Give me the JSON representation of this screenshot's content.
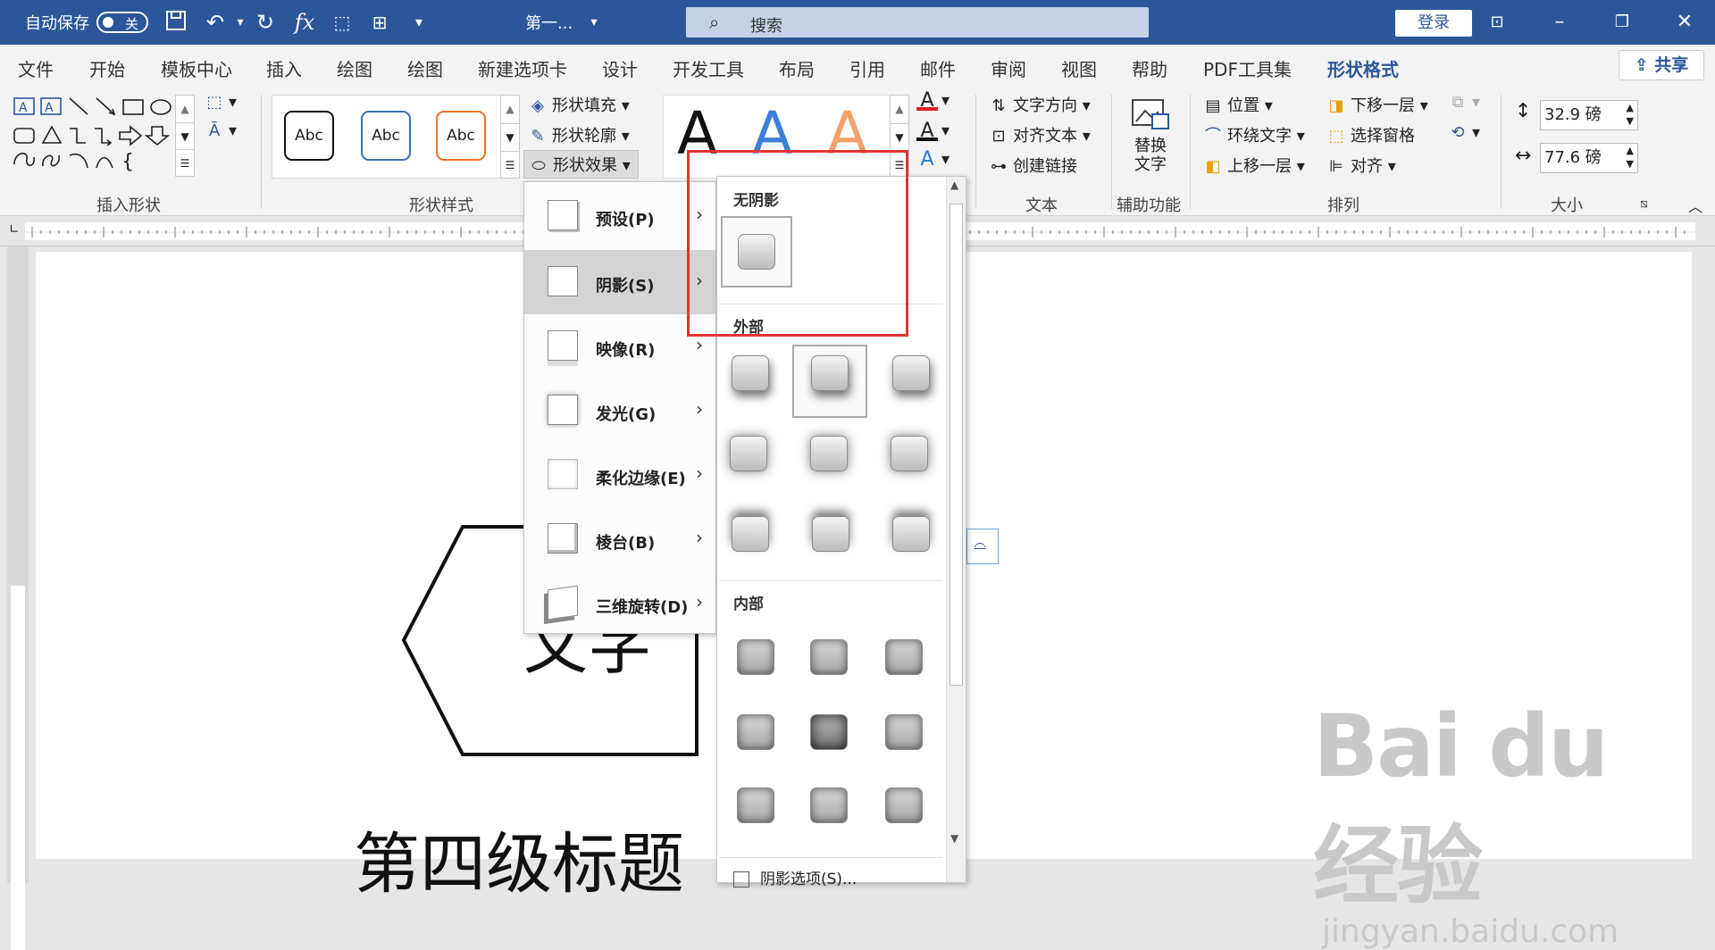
{
  "titlebar": {
    "autosave_label": "自动保存",
    "autosave_state": "关",
    "doc_title": "第一...",
    "search_placeholder": "搜索",
    "login_label": "登录"
  },
  "tabs": [
    "文件",
    "开始",
    "模板中心",
    "插入",
    "绘图",
    "绘图",
    "新建选项卡",
    "设计",
    "开发工具",
    "布局",
    "引用",
    "邮件",
    "审阅",
    "视图",
    "帮助",
    "PDF工具集",
    "形状格式"
  ],
  "share_label": "共享",
  "ribbon": {
    "insert_shapes_label": "插入形状",
    "shape_styles_label": "形状样式",
    "abc_label": "Abc",
    "shape_fill": "形状填充",
    "shape_outline": "形状轮廓",
    "shape_effects": "形状效果",
    "text_direction": "文字方向",
    "align_text": "对齐文本",
    "create_link": "创建链接",
    "text_group_label": "文本",
    "alt_text_line1": "替换",
    "alt_text_line2": "文字",
    "accessibility_label": "辅助功能",
    "position": "位置",
    "wrap_text": "环绕文字",
    "bring_forward": "上移一层",
    "send_backward": "下移一层",
    "selection_pane": "选择窗格",
    "align": "对齐",
    "arrange_label": "排列",
    "height_value": "32.9 磅",
    "width_value": "77.6 磅",
    "size_label": "大小"
  },
  "effects_menu": [
    {
      "label": "预设(P)"
    },
    {
      "label": "阴影(S)"
    },
    {
      "label": "映像(R)"
    },
    {
      "label": "发光(G)"
    },
    {
      "label": "柔化边缘(E)"
    },
    {
      "label": "棱台(B)"
    },
    {
      "label": "三维旋转(D)"
    }
  ],
  "shadow_gallery": {
    "no_shadow": "无阴影",
    "outer": "外部",
    "inner": "内部",
    "options": "阴影选项(S)..."
  },
  "document": {
    "shape_text": "文字",
    "heading_text": "第四级标题"
  },
  "watermark": {
    "main": "Bai du 经验",
    "sub": "jingyan.baidu.com"
  }
}
